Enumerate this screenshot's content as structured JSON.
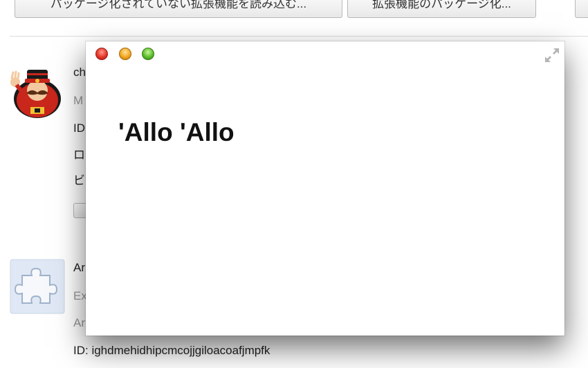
{
  "toolbar": {
    "load_unpacked_label": "パッケージ化されていない拡張機能を読み込む...",
    "pack_extension_label": "拡張機能のパッケージ化..."
  },
  "extensions": [
    {
      "name_partial": "ch",
      "description_partial": "M",
      "id_partial": "ID",
      "line3_partial": "ロ",
      "line4_partial": "ビ",
      "icon": "yeoman-mascot-icon"
    },
    {
      "name_partial": "Ar",
      "description_partial": "Ex",
      "line2_partial": "Ar",
      "id_line": "ID: ighdmehidhipcmcojjgiloacoafjmpfk",
      "icon": "puzzle-piece-icon"
    }
  ],
  "popup": {
    "heading": "'Allo 'Allo",
    "window_controls": [
      "close-icon",
      "minimize-icon",
      "zoom-icon"
    ],
    "fullscreen_icon": "fullscreen-icon"
  },
  "colors": {
    "close": "#e5362a",
    "minimize": "#f2a621",
    "zoom": "#5cbd2a",
    "muted_text": "#999999"
  }
}
